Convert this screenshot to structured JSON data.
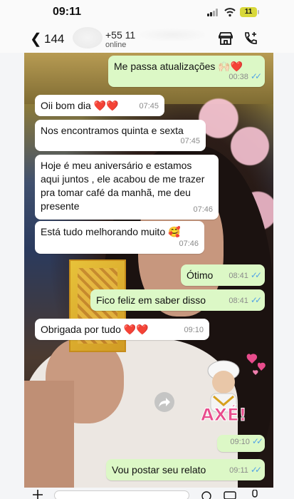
{
  "status": {
    "time": "09:11",
    "battery": "11"
  },
  "header": {
    "back_count": "144",
    "phone": "+55 11",
    "subtitle": "online"
  },
  "messages": [
    {
      "dir": "out",
      "text": "Me passa atualizações 🙌🏻❤️",
      "time": "00:38"
    },
    {
      "dir": "in",
      "text": "Oii bom dia ❤️❤️",
      "time": "07:45"
    },
    {
      "dir": "in",
      "text": "Nos encontramos quinta e sexta",
      "time": "07:45"
    },
    {
      "dir": "in",
      "text": "Hoje é meu aniversário e estamos aqui juntos , ele acabou de me trazer pra tomar café da manhã, me deu presente",
      "time": "07:46"
    },
    {
      "dir": "in",
      "text": "Está tudo melhorando muito 🥰",
      "time": "07:46"
    },
    {
      "dir": "out",
      "text": "Ótimo",
      "time": "08:41"
    },
    {
      "dir": "out",
      "text": "Fico feliz em saber disso",
      "time": "08:41"
    },
    {
      "dir": "in",
      "text": "Obrigada por tudo ❤️❤️",
      "time": "09:10"
    },
    {
      "dir": "out",
      "text": "",
      "time": "09:10"
    },
    {
      "dir": "out",
      "text": "Vou postar seu relato",
      "time": "09:11"
    }
  ],
  "sticker": {
    "caption": "AXÉ!"
  },
  "icons": {
    "store": "storefront-icon",
    "call": "add-call-icon",
    "back": "chevron-left-icon",
    "forward": "forward-icon"
  },
  "colors": {
    "bubble_out": "#dcf8c6",
    "bubble_in": "#ffffff",
    "read_ticks": "#53a3e6"
  }
}
